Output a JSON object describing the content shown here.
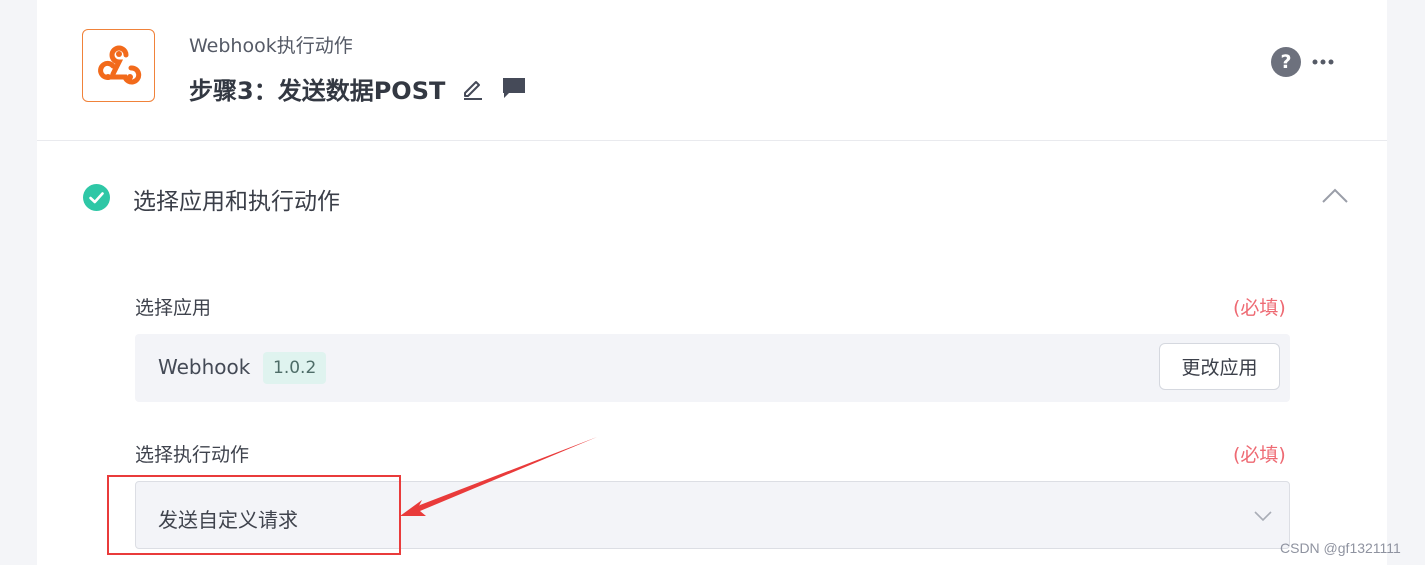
{
  "header": {
    "subtitle": "Webhook执行动作",
    "title": "步骤3：发送数据POST",
    "help_glyph": "?",
    "icons": {
      "logo": "webhook-logo",
      "edit": "pencil-icon",
      "comment": "comment-icon",
      "help": "help-icon",
      "more": "more-icon"
    }
  },
  "section": {
    "title": "选择应用和执行动作",
    "status": "completed",
    "expanded": true
  },
  "app_field": {
    "label": "选择应用",
    "required_text": "(必填)",
    "app_name": "Webhook",
    "version": "1.0.2",
    "change_button": "更改应用"
  },
  "action_field": {
    "label": "选择执行动作",
    "required_text": "(必填)",
    "selected_value": "发送自定义请求"
  },
  "watermark": "CSDN @gf1321111",
  "colors": {
    "accent_orange": "#f0823a",
    "success_green": "#2ec7a6",
    "required_red": "#ee6a73",
    "annotation_red": "#e93b3b"
  }
}
